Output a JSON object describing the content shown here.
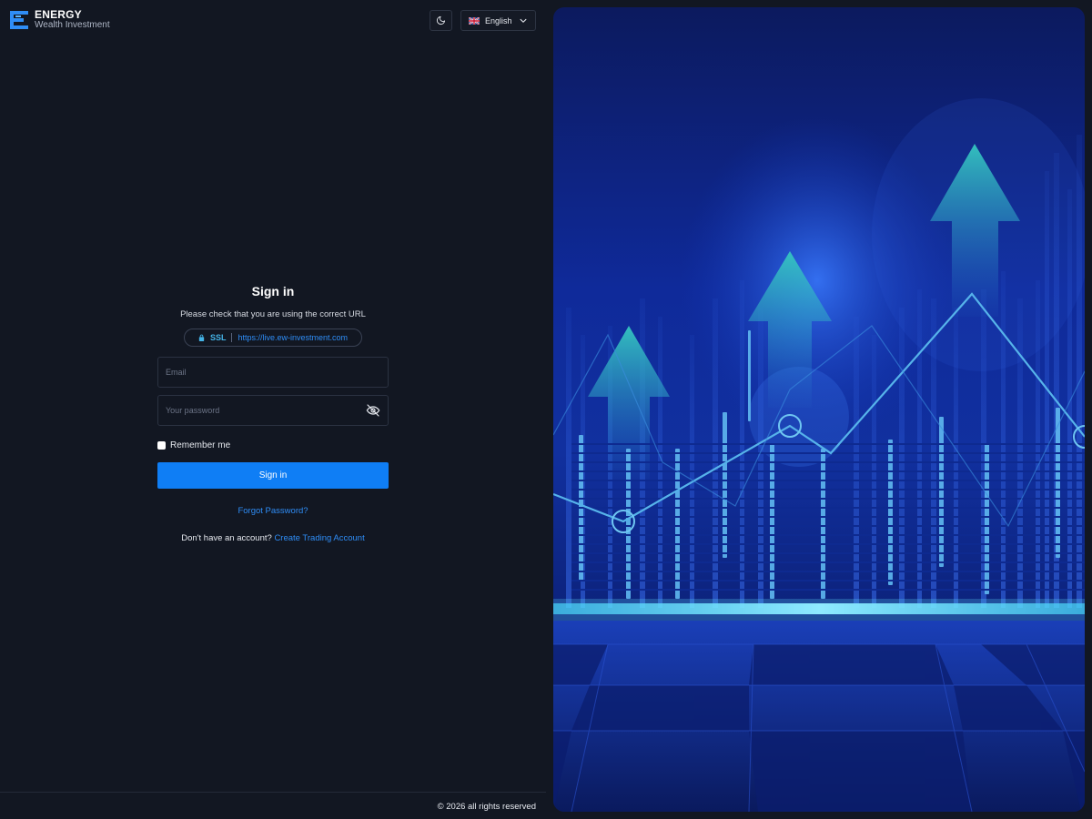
{
  "brand": {
    "title": "ENERGY",
    "subtitle": "Wealth Investment"
  },
  "header": {
    "theme_icon": "moon-icon",
    "language": "English",
    "language_flag": "uk-flag-icon"
  },
  "form": {
    "title": "Sign in",
    "subtitle": "Please check that you are using the correct URL",
    "ssl_label": "SSL",
    "ssl_url": "https://live.ew-investment.com",
    "email_placeholder": "Email",
    "password_placeholder": "Your password",
    "remember_label": "Remember me",
    "signin_label": "Sign in",
    "forgot_label": "Forgot Password?",
    "no_account_label": "Don't have an account?",
    "create_account_label": "Create Trading Account"
  },
  "footer": {
    "copyright": "© 2026 all rights reserved"
  },
  "colors": {
    "background": "#121722",
    "accent": "#0f7ef5",
    "link": "#2f8df6",
    "ssl": "#44b3e6"
  }
}
